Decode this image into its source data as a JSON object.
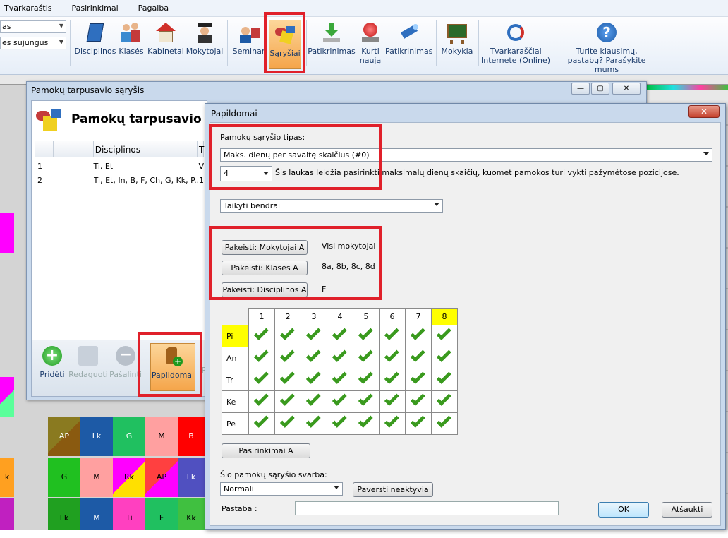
{
  "menu": [
    "Tvarkaraštis",
    "Pasirinkimai",
    "Pagalba"
  ],
  "ribbon": {
    "combo1": "as",
    "combo2": "es sujungus",
    "buttons": [
      {
        "label": "Disciplinos",
        "icon": "book-icon"
      },
      {
        "label": "Klasės",
        "icon": "students-icon"
      },
      {
        "label": "Kabinetai",
        "icon": "house-icon"
      },
      {
        "label": "Mokytojai",
        "icon": "teacher-icon"
      },
      {
        "label": "Seminari",
        "icon": "seminar-icon"
      },
      {
        "label": "Sąryšiai",
        "icon": "shapes-icon"
      },
      {
        "label": "Patikrinimas",
        "icon": "download-icon"
      },
      {
        "label": "Kurti",
        "label2": "naują",
        "icon": "red-light-icon"
      },
      {
        "label": "Patikrinimas",
        "icon": "flashlight-icon"
      },
      {
        "label": "Mokykla",
        "icon": "chalkboard-icon"
      },
      {
        "label": "Tvarkaraščiai",
        "label2": "Internete (Online)",
        "icon": "refresh-icon"
      },
      {
        "label": "Turite klausimų,",
        "label2": "pastabų? Parašykite mums",
        "icon": "help-icon"
      }
    ]
  },
  "relations_window": {
    "title": "Pamokų tarpusavio sąryšis",
    "heading": "Pamokų tarpusavio sąryš",
    "col_disciplinos": "Disciplinos",
    "col_t": "T",
    "rows": [
      {
        "n": "1",
        "disc": "Ti, Et",
        "t": "V"
      },
      {
        "n": "2",
        "disc": "Ti, Et, In, B, F, Ch, G, Kk, P...",
        "t": "1"
      }
    ],
    "buttons": [
      "Pridėti",
      "Redaguoti",
      "Pašalinti",
      "Papildomai",
      "P"
    ]
  },
  "dialog": {
    "title": "Papildomai",
    "type_label": "Pamokų sąryšio tipas:",
    "type_value": "Maks. dienų per savaitę skaičius (#0)",
    "count_value": "4",
    "count_help": "Šis laukas leidžia pasirinkti maksimalų dienų skaičių, kuomet pamokos turi vykti pažymėtose pozicijose.",
    "apply_value": "Taikyti bendrai",
    "change_teachers": "Pakeisti: Mokytojai A",
    "teachers_value": "Visi mokytojai",
    "change_classes": "Pakeisti: Klasės A",
    "classes_value": "8a, 8b, 8c, 8d",
    "change_subjects": "Pakeisti: Disciplinos A",
    "subjects_value": "F",
    "periods": [
      "1",
      "2",
      "3",
      "4",
      "5",
      "6",
      "7",
      "8"
    ],
    "days": [
      "Pi",
      "An",
      "Tr",
      "Ke",
      "Pe"
    ],
    "options_button": "Pasirinkimai A",
    "weight_label": "Šio pamokų sąryšio svarba:",
    "weight_value": "Normali",
    "deactivate_button": "Paversti neaktyvia",
    "note_label": "Pastaba :",
    "note_value": "",
    "ok": "OK",
    "cancel": "Atšaukti"
  },
  "background_cells": [
    "AP",
    "Lk",
    "G",
    "M",
    "B",
    "G",
    "M",
    "Rk",
    "AP",
    "Lk",
    "Lk",
    "M",
    "Ti",
    "F",
    "Kk",
    "k"
  ],
  "colors": {
    "highlight": "#e0202a",
    "yellow": "#ffff00",
    "check": "#3a9a1e"
  }
}
